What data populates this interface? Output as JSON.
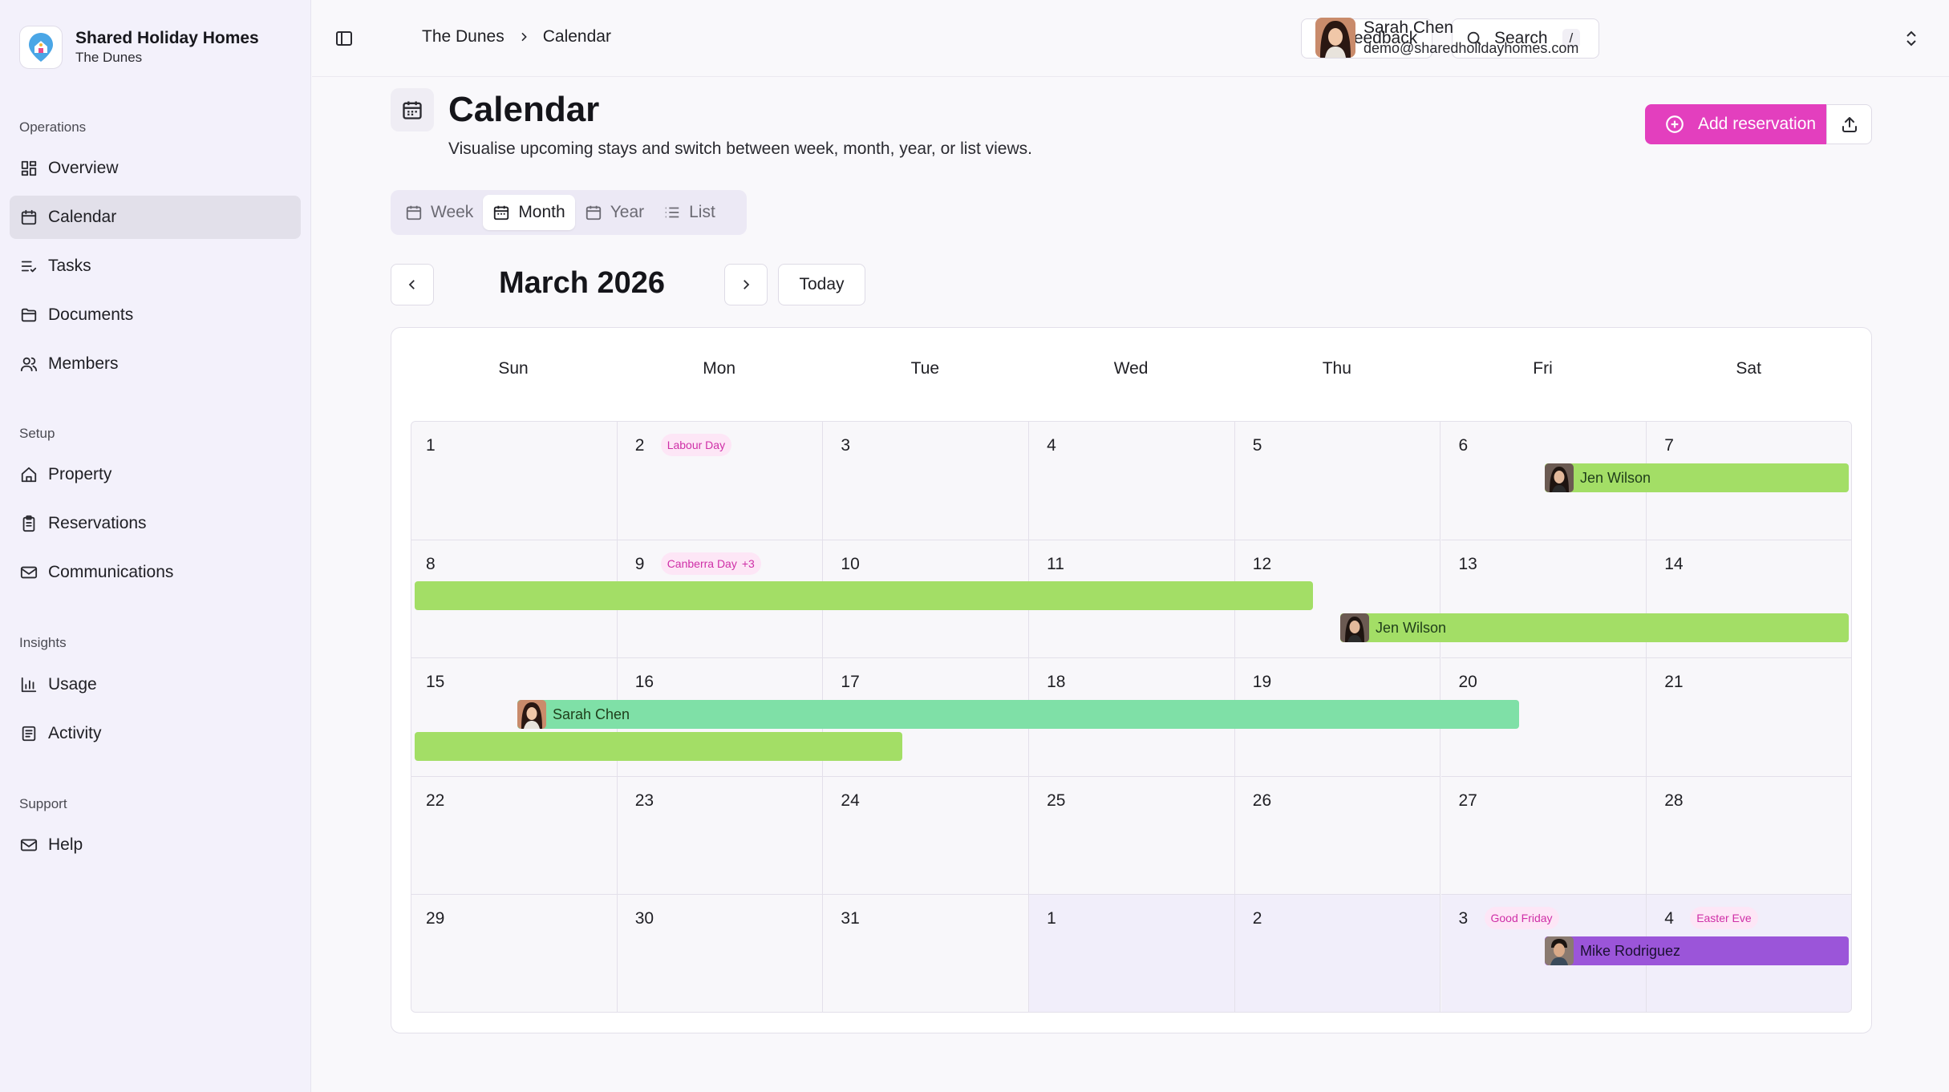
{
  "sidebar": {
    "brand": {
      "name": "Shared Holiday Homes",
      "property": "The Dunes"
    },
    "sections": [
      {
        "title": "Operations",
        "items": [
          {
            "label": "Overview",
            "icon": "dashboard-icon"
          },
          {
            "label": "Calendar",
            "icon": "calendar-icon",
            "active": true
          },
          {
            "label": "Tasks",
            "icon": "tasks-icon"
          },
          {
            "label": "Documents",
            "icon": "folder-icon"
          },
          {
            "label": "Members",
            "icon": "users-icon"
          }
        ]
      },
      {
        "title": "Setup",
        "items": [
          {
            "label": "Property",
            "icon": "home-icon"
          },
          {
            "label": "Reservations",
            "icon": "clipboard-icon"
          },
          {
            "label": "Communications",
            "icon": "mail-icon"
          }
        ]
      },
      {
        "title": "Insights",
        "items": [
          {
            "label": "Usage",
            "icon": "bar-chart-icon"
          },
          {
            "label": "Activity",
            "icon": "activity-log-icon"
          }
        ]
      },
      {
        "title": "Support",
        "items": [
          {
            "label": "Help",
            "icon": "mail-icon"
          }
        ]
      }
    ]
  },
  "topbar": {
    "breadcrumb": [
      "The Dunes",
      "Calendar"
    ],
    "feedback_label": "Feedback",
    "search_label": "Search",
    "search_shortcut": "/",
    "user": {
      "name": "Sarah Chen",
      "email": "demo@sharedholidayhomes.com"
    }
  },
  "header": {
    "title": "Calendar",
    "subtitle": "Visualise upcoming stays and switch between week, month, year, or list views.",
    "add_label": "Add reservation"
  },
  "views": [
    {
      "label": "Week",
      "icon": "calendar-icon"
    },
    {
      "label": "Month",
      "icon": "calendar-icon",
      "active": true
    },
    {
      "label": "Year",
      "icon": "calendar-icon"
    },
    {
      "label": "List",
      "icon": "list-icon"
    }
  ],
  "month_nav": {
    "label": "March 2026",
    "today_label": "Today"
  },
  "calendar": {
    "weekdays": [
      "Sun",
      "Mon",
      "Tue",
      "Wed",
      "Thu",
      "Fri",
      "Sat"
    ],
    "weeks": [
      [
        {
          "d": "1"
        },
        {
          "d": "2",
          "holiday": "Labour Day"
        },
        {
          "d": "3"
        },
        {
          "d": "4"
        },
        {
          "d": "5"
        },
        {
          "d": "6"
        },
        {
          "d": "7"
        }
      ],
      [
        {
          "d": "8"
        },
        {
          "d": "9",
          "holiday": "Canberra Day",
          "more": "+3"
        },
        {
          "d": "10"
        },
        {
          "d": "11"
        },
        {
          "d": "12"
        },
        {
          "d": "13"
        },
        {
          "d": "14"
        }
      ],
      [
        {
          "d": "15"
        },
        {
          "d": "16"
        },
        {
          "d": "17"
        },
        {
          "d": "18"
        },
        {
          "d": "19"
        },
        {
          "d": "20"
        },
        {
          "d": "21"
        }
      ],
      [
        {
          "d": "22"
        },
        {
          "d": "23"
        },
        {
          "d": "24"
        },
        {
          "d": "25"
        },
        {
          "d": "26"
        },
        {
          "d": "27"
        },
        {
          "d": "28"
        }
      ],
      [
        {
          "d": "29"
        },
        {
          "d": "30"
        },
        {
          "d": "31"
        },
        {
          "d": "1",
          "other": true
        },
        {
          "d": "2",
          "other": true
        },
        {
          "d": "3",
          "other": true,
          "holiday": "Good Friday"
        },
        {
          "d": "4",
          "other": true,
          "holiday": "Easter Eve"
        }
      ]
    ],
    "reservations": [
      {
        "guest": "Jen Wilson",
        "color": "#a3de66",
        "start": "2026-03-06",
        "end": "2026-03-07"
      },
      {
        "guest": "",
        "color": "#a3de66",
        "start": "2026-03-08",
        "end": "2026-03-12"
      },
      {
        "guest": "Jen Wilson",
        "color": "#a3de66",
        "start": "2026-03-12",
        "end": "2026-03-14"
      },
      {
        "guest": "Sarah Chen",
        "color": "#7fe0a7",
        "start": "2026-03-15",
        "end": "2026-03-20"
      },
      {
        "guest": "",
        "color": "#a3de66",
        "start": "2026-03-15",
        "end": "2026-03-17"
      },
      {
        "guest": "Mike Rodriguez",
        "color": "#9b55d9",
        "start": "2026-04-03",
        "end": "2026-04-04"
      }
    ]
  },
  "colors": {
    "accent": "#e33fbe",
    "holiday_bg": "#fde6f6",
    "holiday_text": "#cf2fa7"
  }
}
